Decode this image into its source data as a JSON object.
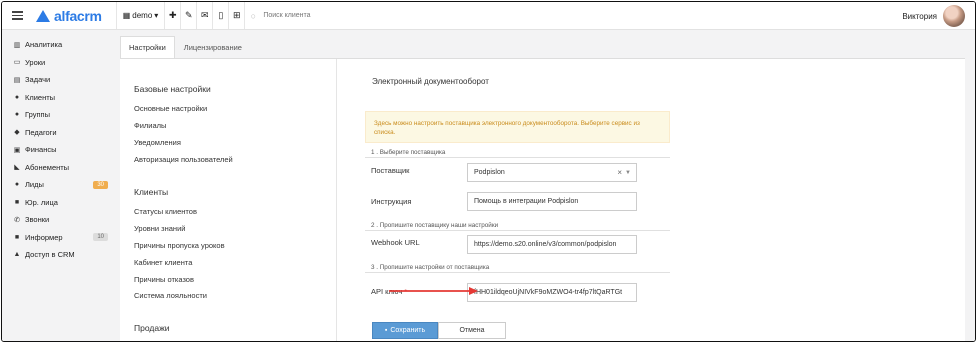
{
  "brand": {
    "name": "alfacrm"
  },
  "toolbar": {
    "branch": "demo",
    "search_placeholder": "Поиск клиента",
    "buttons": [
      "plus-icon",
      "wrench-icon",
      "mail-icon",
      "phone-icon",
      "cart-icon"
    ]
  },
  "user": {
    "name": "Виктория"
  },
  "sidebar": {
    "items": [
      {
        "label": "Аналитика",
        "icon": "analytics-icon"
      },
      {
        "label": "Уроки",
        "icon": "calendar-icon"
      },
      {
        "label": "Задачи",
        "icon": "tasks-icon"
      },
      {
        "label": "Клиенты",
        "icon": "user-icon"
      },
      {
        "label": "Группы",
        "icon": "users-icon"
      },
      {
        "label": "Педагоги",
        "icon": "graduation-icon"
      },
      {
        "label": "Финансы",
        "icon": "money-icon"
      },
      {
        "label": "Абонементы",
        "icon": "tag-icon"
      },
      {
        "label": "Лиды",
        "icon": "add-user-icon",
        "badge": "30"
      },
      {
        "label": "Юр. лица",
        "icon": "briefcase-icon"
      },
      {
        "label": "Звонки",
        "icon": "phone-icon"
      },
      {
        "label": "Информер",
        "icon": "informer-icon",
        "badge": "10"
      },
      {
        "label": "Доступ в CRM",
        "icon": "lock-icon"
      }
    ]
  },
  "tabs": [
    {
      "label": "Настройки",
      "active": true
    },
    {
      "label": "Лицензирование",
      "active": false
    }
  ],
  "settings_nav": {
    "sections": [
      {
        "title": "Базовые настройки",
        "links": [
          "Основные настройки",
          "Филиалы",
          "Уведомления",
          "Авторизация пользователей"
        ]
      },
      {
        "title": "Клиенты",
        "links": [
          "Статусы клиентов",
          "Уровни знаний",
          "Причины пропуска уроков",
          "Кабинет клиента",
          "Причины отказов",
          "Система лояльности"
        ]
      },
      {
        "title": "Продажи",
        "links": []
      }
    ]
  },
  "form": {
    "title": "Электронный документооборот",
    "alert": "Здесь можно настроить поставщика электронного документооборота. Выберите сервис из списка.",
    "step1": "1 . Выберите поставщика",
    "provider_label": "Поставщик",
    "provider_value": "Podpislon",
    "instruction_label": "Инструкция",
    "instruction_value": "Помощь в интеграции Podpislon",
    "step2": "2 . Пропишите поставщику наши настройки",
    "webhook_label": "Webhook URL",
    "webhook_value": "https://demo.s20.online/v3/common/podpislon",
    "step3": "3 . Пропишите настройки от поставщика",
    "api_label": "API ключ",
    "api_required": "*",
    "api_value": "fHH01ildqeoUjNIVkF9oMZWO4-tr4fp7ltQaRTGt",
    "save_label": "Сохранить",
    "cancel_label": "Отмена"
  },
  "colors": {
    "brand": "#2c7be5",
    "save": "#5b9bd5",
    "arrow": "#e53935",
    "alert_bg": "#fcf8e3"
  }
}
